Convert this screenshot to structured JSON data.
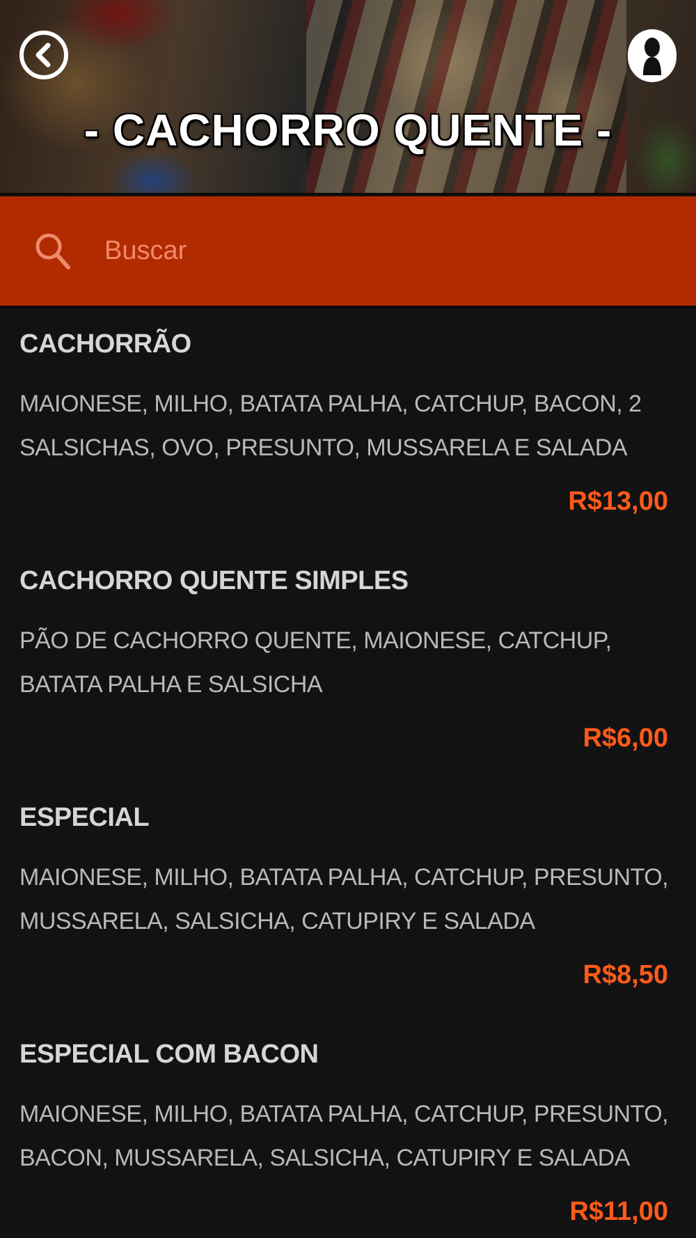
{
  "header": {
    "title": "- CACHORRO QUENTE -",
    "back_icon": "chevron-left-icon",
    "profile_icon": "user-silhouette-icon"
  },
  "search": {
    "placeholder": "Buscar",
    "icon": "search-icon",
    "bar_color": "#b22a00"
  },
  "colors": {
    "background": "#121212",
    "accent": "#b22a00",
    "price": "#ff5a1a",
    "text": "#d6d6d6"
  },
  "menu": {
    "items": [
      {
        "name": "CACHORRÃO",
        "description": "MAIONESE, MILHO, BATATA PALHA, CATCHUP, BACON, 2 SALSICHAS, OVO, PRESUNTO, MUSSARELA E SALADA",
        "price": "R$13,00"
      },
      {
        "name": "CACHORRO QUENTE SIMPLES",
        "description": "PÃO DE CACHORRO QUENTE, MAIONESE, CATCHUP, BATATA PALHA E SALSICHA",
        "price": "R$6,00"
      },
      {
        "name": "ESPECIAL",
        "description": "MAIONESE, MILHO, BATATA PALHA, CATCHUP, PRESUNTO, MUSSARELA, SALSICHA, CATUPIRY E SALADA",
        "price": "R$8,50"
      },
      {
        "name": "ESPECIAL COM BACON",
        "description": "MAIONESE, MILHO, BATATA PALHA, CATCHUP, PRESUNTO, BACON, MUSSARELA, SALSICHA, CATUPIRY E SALADA",
        "price": "R$11,00"
      }
    ]
  }
}
